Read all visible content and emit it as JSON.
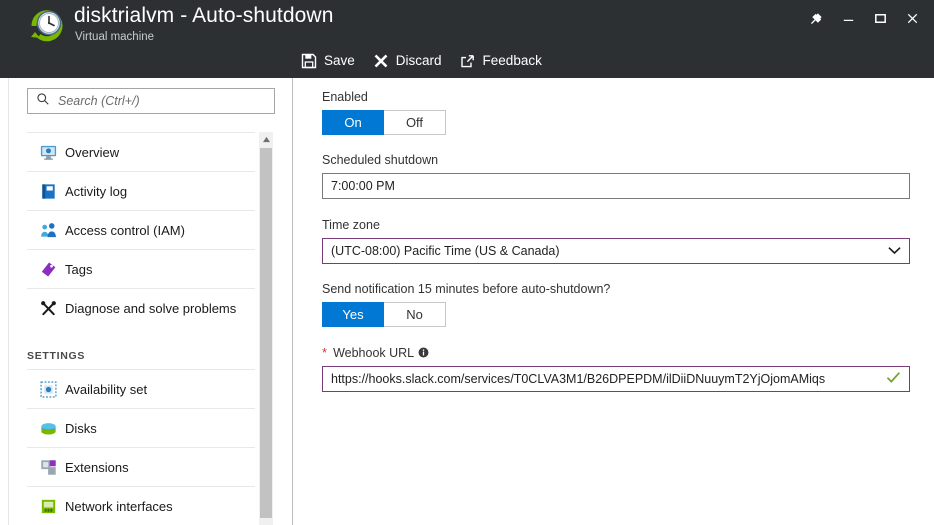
{
  "window": {
    "title": "disktrialvm - Auto-shutdown",
    "subtitle": "Virtual machine",
    "icon": "clock-refresh-icon",
    "controls": [
      {
        "name": "pin-button",
        "label": "Pin"
      },
      {
        "name": "minimize-button",
        "label": "Minimize"
      },
      {
        "name": "maximize-button",
        "label": "Maximize"
      },
      {
        "name": "close-button",
        "label": "Close"
      }
    ]
  },
  "toolbar": {
    "save_label": "Save",
    "discard_label": "Discard",
    "feedback_label": "Feedback"
  },
  "sidebar": {
    "search_placeholder": "Search (Ctrl+/)",
    "search_value": "",
    "items": [
      {
        "label": "Overview",
        "icon": "monitor-icon"
      },
      {
        "label": "Activity log",
        "icon": "book-icon"
      },
      {
        "label": "Access control (IAM)",
        "icon": "people-icon"
      },
      {
        "label": "Tags",
        "icon": "tag-icon"
      },
      {
        "label": "Diagnose and solve problems",
        "icon": "wrench-screwdriver-icon"
      }
    ],
    "section_label": "SETTINGS",
    "settings_items": [
      {
        "label": "Availability set",
        "icon": "availability-set-icon"
      },
      {
        "label": "Disks",
        "icon": "disk-icon"
      },
      {
        "label": "Extensions",
        "icon": "extensions-icon"
      },
      {
        "label": "Network interfaces",
        "icon": "network-interface-icon"
      }
    ]
  },
  "form": {
    "enabled_label": "Enabled",
    "enabled_on": "On",
    "enabled_off": "Off",
    "enabled_value": "On",
    "scheduled_label": "Scheduled shutdown",
    "scheduled_value": "7:00:00 PM",
    "timezone_label": "Time zone",
    "timezone_value": "(UTC-08:00) Pacific Time (US & Canada)",
    "notify_label": "Send notification 15 minutes before auto-shutdown?",
    "notify_yes": "Yes",
    "notify_no": "No",
    "notify_value": "Yes",
    "webhook_required_marker": "*",
    "webhook_label": "Webhook URL",
    "webhook_value": "https://hooks.slack.com/services/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",
    "webhook_valid_icon": "checkmark-icon"
  },
  "colors": {
    "titlebar": "#2d3033",
    "accent_blue": "#0078d4",
    "field_purple": "#7a3b7a",
    "valid_green": "#76a12c",
    "required_red": "#d13438"
  }
}
